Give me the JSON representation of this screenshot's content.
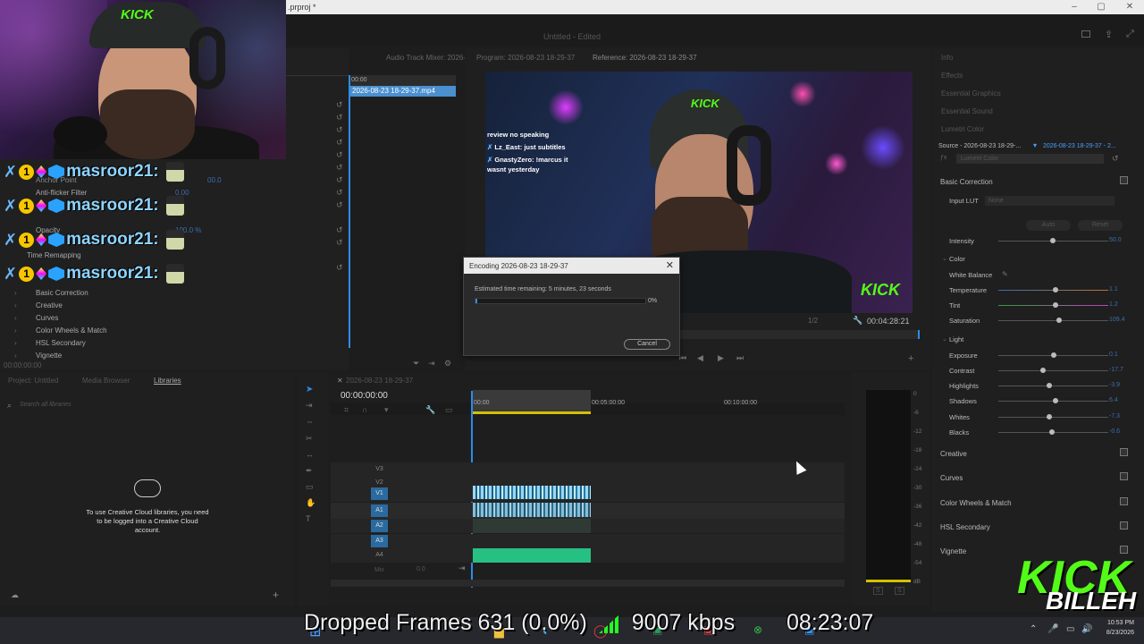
{
  "titlebar": {
    "title": ".prproj *"
  },
  "app": {
    "center_title": "Untitled - Edited"
  },
  "left_tabs": [
    "Audio Track Mixer: 2026-08-23"
  ],
  "source_tabs": [
    "Program: 2026-08-23 18-29-37",
    "Reference: 2026-08-23 18-29-37"
  ],
  "right_tabs": [
    "Info",
    "Effects",
    "Essential Graphics",
    "Essential Sound",
    "Lumetri Color"
  ],
  "chat": {
    "name": "masroor21:",
    "rows": 4
  },
  "effect_controls": {
    "labels": [
      "Anchor Point",
      "Anti-flicker Filter",
      "Opacity",
      "Time Remapping",
      "Basic Correction",
      "Creative",
      "Curves",
      "Color Wheels & Match",
      "HSL Secondary",
      "Vignette"
    ],
    "timecode": "00:00:00:00",
    "anchor_val": "00.0",
    "flicker_val": "0.00",
    "opacity_val": "100.0 %"
  },
  "bin": {
    "header": "00:00",
    "clip": "2026-08-23 18-29-37.mp4"
  },
  "program_monitor": {
    "chat_lines": [
      "review no speaking",
      "Lz_East: just subtitles",
      "GnastyZero: !marcus it",
      "wasnt yesterday"
    ],
    "timecode": "00:04:28:21",
    "zoom": "1/2"
  },
  "dialog": {
    "title": "Encoding 2026-08-23 18-29-37",
    "estimate": "Estimated time remaining: 5 minutes, 23 seconds",
    "progress": 0.01,
    "percent": "0%",
    "cancel": "Cancel"
  },
  "lumetri": {
    "source": "Source - 2026-08-23 18-29-...",
    "target": "2026-08-23 18-29-37 - 2...",
    "fx_label": "Lumetri Color",
    "basic": "Basic Correction",
    "input_lut": "Input LUT",
    "lut_val": "None",
    "auto": "Auto",
    "reset": "Reset",
    "intensity": "Intensity",
    "intensity_val": "50.0",
    "color": "Color",
    "white_balance": "White Balance",
    "light": "Light",
    "rows": [
      {
        "label": "Temperature",
        "val": "1.1",
        "pos": 0.52
      },
      {
        "label": "Tint",
        "val": "1.2",
        "pos": 0.52
      },
      {
        "label": "Saturation",
        "val": "109.4",
        "pos": 0.55
      },
      {
        "label": "Exposure",
        "val": "0.1",
        "pos": 0.5
      },
      {
        "label": "Contrast",
        "val": "-17.7",
        "pos": 0.41
      },
      {
        "label": "Highlights",
        "val": "-3.9",
        "pos": 0.46
      },
      {
        "label": "Shadows",
        "val": "6.4",
        "pos": 0.52
      },
      {
        "label": "Whites",
        "val": "-7.3",
        "pos": 0.46
      },
      {
        "label": "Blacks",
        "val": "-0.6",
        "pos": 0.49
      }
    ],
    "sections": [
      "Creative",
      "Curves",
      "Color Wheels & Match",
      "HSL Secondary",
      "Vignette"
    ]
  },
  "project": {
    "tabs": [
      "Project: Untitled",
      "Media Browser",
      "Libraries"
    ],
    "search_placeholder": "Search all libraries",
    "message": "To use Creative Cloud libraries, you need to be logged into a Creative Cloud account."
  },
  "timeline": {
    "tab": "2026-08-23 18-29-37",
    "timecode": "00:00:00:00",
    "ruler": [
      "00:00",
      "00:05:00:00",
      "00:10:00:00"
    ],
    "video_tracks": [
      "V3",
      "V2",
      "V1"
    ],
    "audio_tracks": [
      "A1",
      "A2",
      "A3",
      "A4"
    ],
    "master": "Mix",
    "master_val": "0.0"
  },
  "meter": {
    "scale": [
      "0",
      "-6",
      "-12",
      "-18",
      "-24",
      "-30",
      "-36",
      "-42",
      "-48",
      "-54",
      "dB"
    ],
    "solo": [
      "S",
      "S"
    ]
  },
  "stats": {
    "dropped": "Dropped Frames 631 (0.0%)",
    "kbps": "9007 kbps",
    "time": "08:23:07"
  },
  "taskbar": {
    "clock_time": "10:53 PM",
    "clock_date": "8/23/2026"
  },
  "brand": {
    "kick": "KICK",
    "name": "BILLEH"
  }
}
